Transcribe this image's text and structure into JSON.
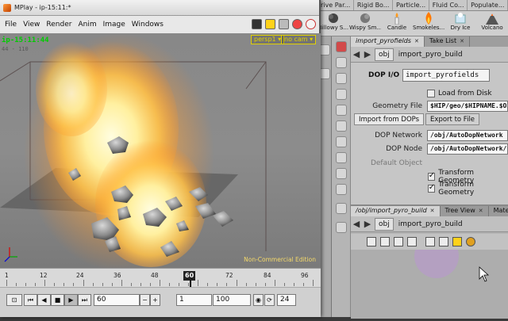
{
  "houdini": {
    "shelf_tabs": [
      "rive Par...",
      "Rigid Bo...",
      "Particle...",
      "Fluid Co...",
      "Populate..."
    ],
    "shelf_tools": [
      {
        "label": "Billowy S...",
        "icon": "billowy-smoke-icon"
      },
      {
        "label": "Wispy Sm...",
        "icon": "wispy-smoke-icon"
      },
      {
        "label": "Candle",
        "icon": "candle-icon"
      },
      {
        "label": "Smokeles...",
        "icon": "smokeless-flame-icon"
      },
      {
        "label": "Dry Ice",
        "icon": "dry-ice-icon"
      },
      {
        "label": "Volcano",
        "icon": "volcano-icon"
      }
    ],
    "param_pane": {
      "tabs": [
        "import_pyrofields",
        "Take List"
      ],
      "path": {
        "network": "obj",
        "node": "import_pyro_build"
      },
      "node_type": "DOP I/O",
      "node_name": "import_pyrofields",
      "load_from_disk_label": "Load from Disk",
      "geometry_file_label": "Geometry File",
      "geometry_file_value": "$HIP/geo/$HIPNAME.$OS",
      "sub_tabs": [
        "Import from DOPs",
        "Export to File"
      ],
      "dop_network_label": "DOP Network",
      "dop_network_value": "/obj/AutoDopNetwork",
      "dop_node_label": "DOP Node",
      "dop_node_value": "/obj/AutoDopNetwork/",
      "default_object_label": "Default Object",
      "transform_geometry_1": "Transform Geometry",
      "transform_geometry_2": "Transform Geometry"
    },
    "network_pane": {
      "tabs": [
        "/obj/import_pyro_build",
        "Tree View",
        "Material P"
      ],
      "path": {
        "network": "obj",
        "node": "import_pyro_build"
      }
    }
  },
  "mplay": {
    "title": "MPlay - ip-15:11:*",
    "menu": [
      "File",
      "View",
      "Render",
      "Anim",
      "Image",
      "Windows"
    ],
    "frame_label": "ip-15:11:44",
    "frame_sub": "44 - 110",
    "camera_buttons": [
      "persp1 ▾",
      "no cam ▾"
    ],
    "watermark": "Non-Commercial Edition",
    "timeline": {
      "ticks": [
        1,
        12,
        24,
        36,
        48,
        60,
        72,
        84,
        96
      ],
      "current_frame": "60"
    },
    "transport": {
      "frame_field": "60",
      "start_field": "1",
      "end_field": "100",
      "fps_field": "24"
    }
  },
  "colors": {
    "frame_label": "#00cc00",
    "camera_button": "#e0d000",
    "flame_core": "#fff3b0",
    "flame_edge": "#ff9a1a"
  }
}
